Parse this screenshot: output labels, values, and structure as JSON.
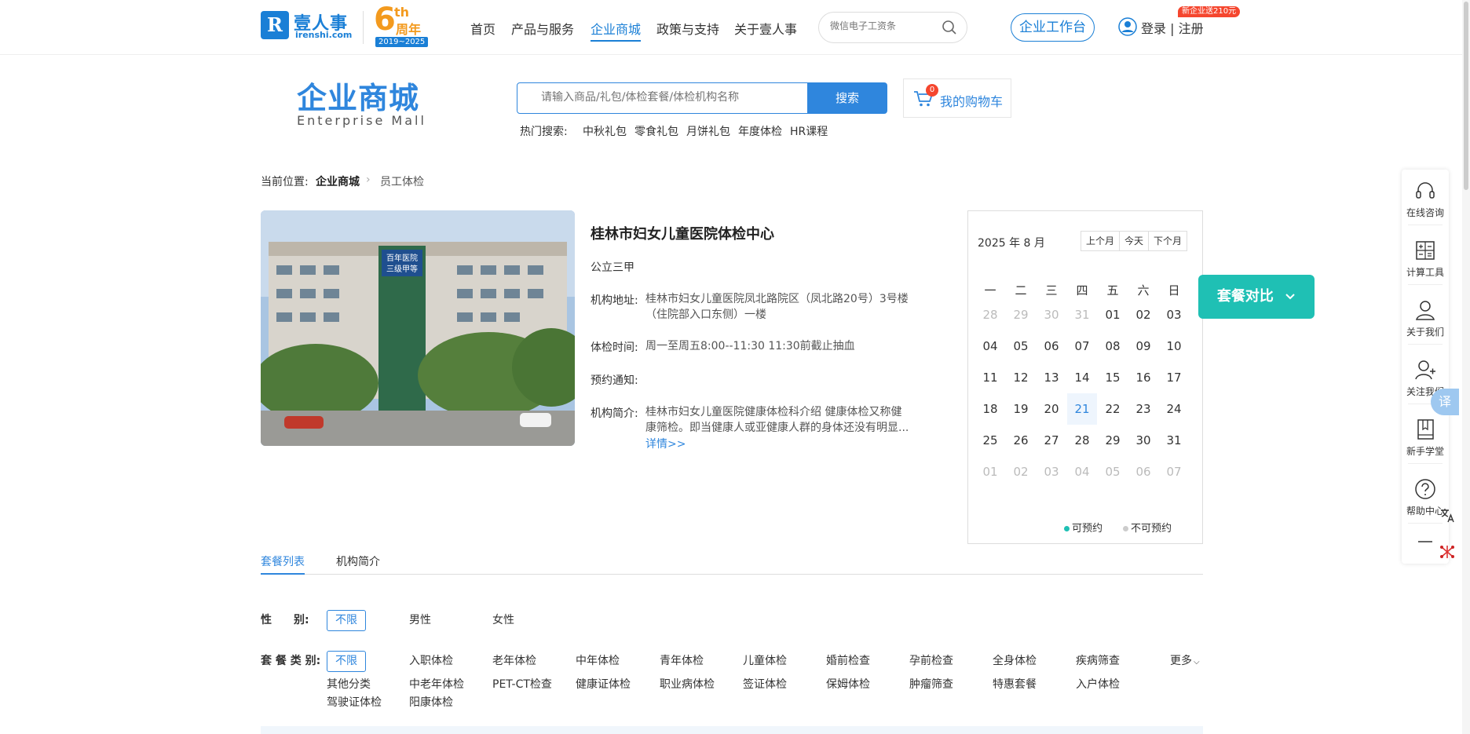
{
  "brand": {
    "name": "壹人事",
    "url": "irenshi.com",
    "anniv_num": "6",
    "anniv_th": "th",
    "anniv_zh": "周年",
    "anniv_years": "2019~2025"
  },
  "nav": {
    "items": [
      "首页",
      "产品与服务",
      "企业商城",
      "政策与支持",
      "关于壹人事"
    ],
    "active_index": 2
  },
  "top_search": {
    "placeholder": "微信电子工资条"
  },
  "workbench_label": "企业工作台",
  "auth": {
    "login": "登录",
    "sep": "|",
    "register": "注册",
    "promo": "新企业送210元"
  },
  "mall": {
    "title": "企业商城",
    "subtitle": "Enterprise Mall",
    "search_placeholder": "请输入商品/礼包/体检套餐/体检机构名称",
    "search_button": "搜索",
    "cart_label": "我的购物车",
    "cart_count": "0",
    "hot_label": "热门搜索:",
    "hot_items": [
      "中秋礼包",
      "零食礼包",
      "月饼礼包",
      "年度体检",
      "HR课程"
    ]
  },
  "breadcrumb": {
    "prefix": "当前位置:",
    "items": [
      "企业商城",
      "员工体检"
    ]
  },
  "hospital": {
    "name": "桂林市妇女儿童医院体检中心",
    "grade": "公立三甲",
    "address_label": "机构地址:",
    "address": "桂林市妇女儿童医院凤北路院区（凤北路20号）3号楼（住院部入口东侧）一楼",
    "hours_label": "体检时间:",
    "hours": "周一至周五8:00--11:30 11:30前截止抽血",
    "notice_label": "预约通知:",
    "intro_label": "机构简介:",
    "intro": "桂林市妇女儿童医院健康体检科介绍 健康体检又称健康筛检。即当健康人或亚健康人群的身体还没有明显...",
    "more": "详情>>",
    "photo_sign": "百年医院 三级甲等"
  },
  "calendar": {
    "title": "2025 年 8 月",
    "buttons": [
      "上个月",
      "今天",
      "下个月"
    ],
    "weekdays": [
      "一",
      "二",
      "三",
      "四",
      "五",
      "六",
      "日"
    ],
    "weeks": [
      [
        "28",
        "29",
        "30",
        "31",
        "01",
        "02",
        "03"
      ],
      [
        "04",
        "05",
        "06",
        "07",
        "08",
        "09",
        "10"
      ],
      [
        "11",
        "12",
        "13",
        "14",
        "15",
        "16",
        "17"
      ],
      [
        "18",
        "19",
        "20",
        "21",
        "22",
        "23",
        "24"
      ],
      [
        "25",
        "26",
        "27",
        "28",
        "29",
        "30",
        "31"
      ],
      [
        "01",
        "02",
        "03",
        "04",
        "05",
        "06",
        "07"
      ]
    ],
    "today": "21",
    "legend_available": "可预约",
    "legend_unavailable": "不可预约",
    "colors": {
      "available": "#1fc0b4",
      "unavailable": "#cccccc"
    }
  },
  "compare_label": "套餐对比",
  "sidebar": {
    "items": [
      "在线咨询",
      "计算工具",
      "关于我们",
      "关注我们",
      "新手学堂",
      "帮助中心"
    ]
  },
  "translate_label": "译",
  "tabs": [
    "套餐列表",
    "机构简介"
  ],
  "filters": {
    "gender_label": "性　　别:",
    "gender_options": [
      "不限",
      "男性",
      "女性"
    ],
    "type_label": "套 餐 类 别:",
    "type_row1": [
      "不限",
      "入职体检",
      "老年体检",
      "中年体检",
      "青年体检",
      "儿童体检",
      "婚前检查",
      "孕前检查",
      "全身体检",
      "疾病筛查"
    ],
    "type_row2": [
      "其他分类",
      "中老年体检",
      "PET-CT检查",
      "健康证体检",
      "职业病体检",
      "签证体检",
      "保姆体检",
      "肿瘤筛查",
      "特惠套餐",
      "入户体检"
    ],
    "type_row3": [
      "驾驶证体检",
      "阳康体检"
    ],
    "more": "更多"
  },
  "accent": "#2f86dd"
}
